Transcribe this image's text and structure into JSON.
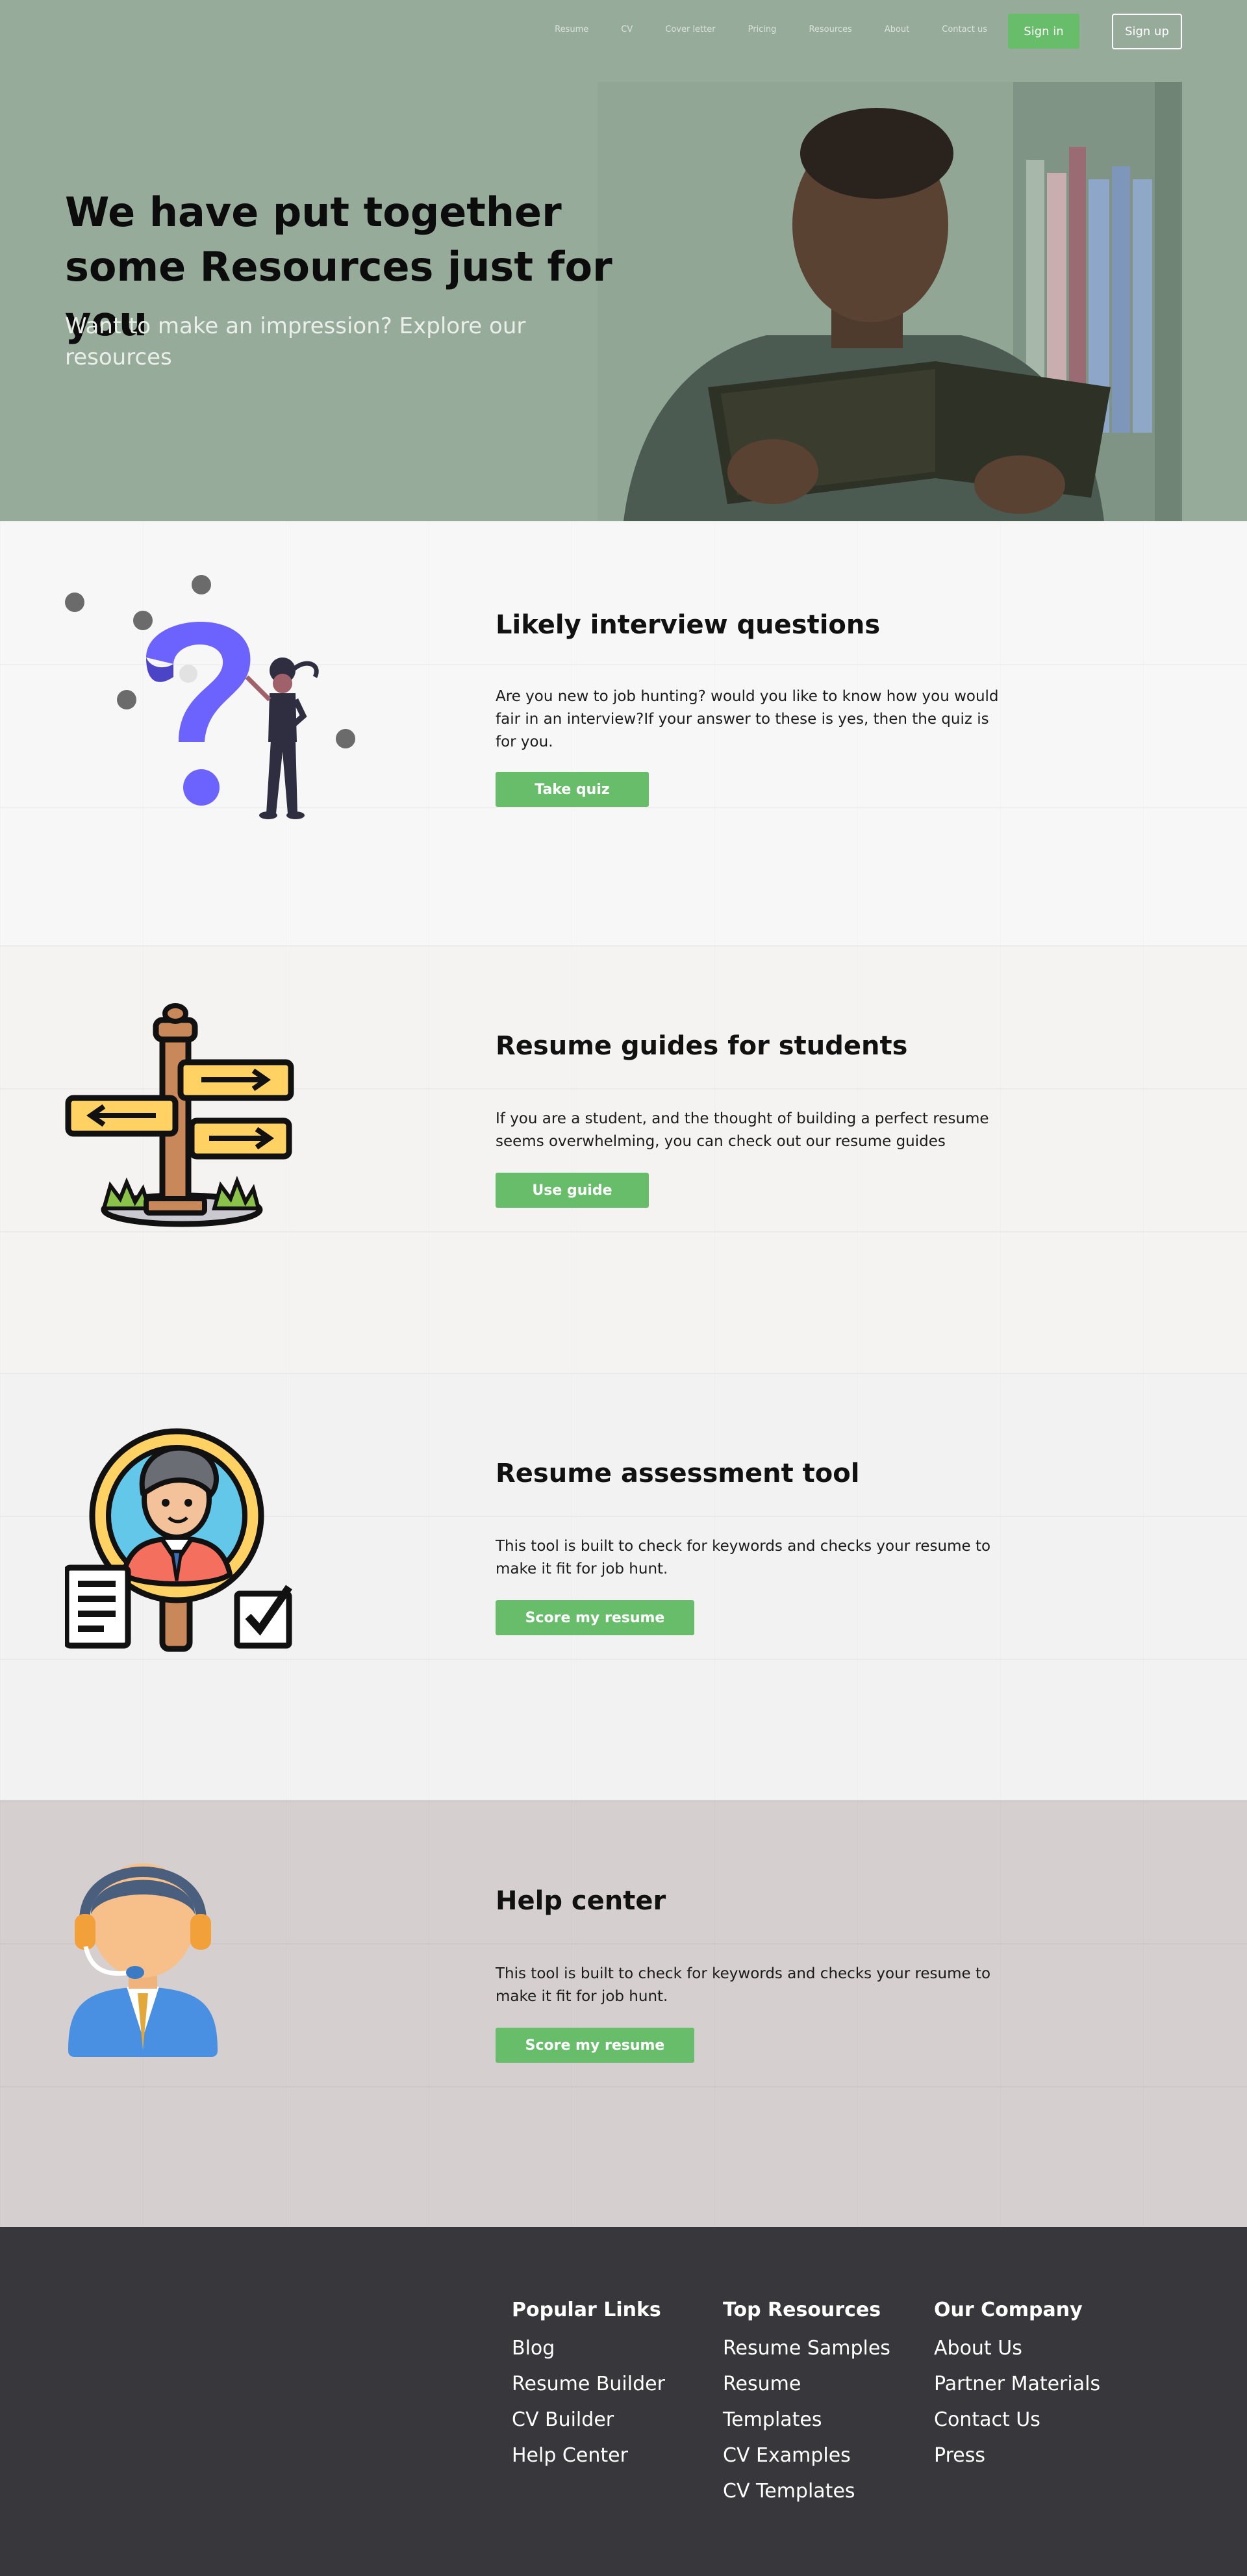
{
  "nav": {
    "links": [
      "Resume",
      "CV",
      "Cover letter",
      "Pricing",
      "Resources",
      "About",
      "Contact us"
    ],
    "sign_in": "Sign in",
    "sign_up": "Sign up"
  },
  "hero": {
    "title": "We have put together some Resources just for you",
    "subtitle": "Want to make an impression? Explore our resources"
  },
  "sections": [
    {
      "title": "Likely interview questions",
      "body": "Are you new to job hunting? would you like to know how you would  fair in an interview?If your answer to these is yes, then the quiz is  for you.",
      "button": "Take quiz",
      "icon": "question-mark-person-illustration"
    },
    {
      "title": "Resume guides for students",
      "body": "If you are a student, and the thought of building a perfect resume seems overwhelming, you can check out our resume guides",
      "button": "Use guide",
      "icon": "signpost-illustration"
    },
    {
      "title": "Resume assessment tool",
      "body": "This tool is built to check for keywords and  checks your resume to make it fit for job hunt.",
      "button": "Score my resume",
      "icon": "magnifier-person-checklist-illustration"
    },
    {
      "title": "Help center",
      "body": "This tool is built to check for keywords and  checks your resume to make it fit for job hunt.",
      "button": "Score my resume",
      "icon": "support-agent-headset-illustration"
    }
  ],
  "footer": {
    "columns": [
      {
        "heading": "Popular Links",
        "items": [
          "Blog",
          "Resume Builder",
          "CV Builder",
          "Help Center"
        ]
      },
      {
        "heading": "Top Resources",
        "items": [
          "Resume Samples",
          "Resume",
          "Templates",
          "CV Examples",
          "CV Templates"
        ]
      },
      {
        "heading": "Our Company",
        "items": [
          "About Us",
          "Partner Materials",
          "Contact Us",
          "Press"
        ]
      }
    ]
  },
  "colors": {
    "hero_bg": "#96ab9a",
    "accent_green": "#68bd6b",
    "section1_bg": "#f7f7f7",
    "section2_bg": "#f4f3f2",
    "section3_bg": "#f2f2f2",
    "section4_bg": "#d5cfcf",
    "footer_bg": "#37373c"
  }
}
